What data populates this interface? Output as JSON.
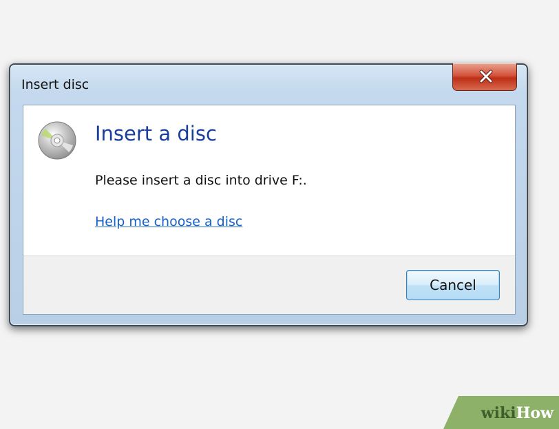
{
  "window": {
    "title": "Insert disc"
  },
  "dialog": {
    "main_instruction": "Insert a disc",
    "message": "Please insert a disc into drive F:.",
    "help_link": "Help me choose a disc",
    "cancel_label": "Cancel",
    "icons": {
      "close": "close-icon",
      "disc": "disc-icon"
    }
  },
  "watermark": {
    "wiki": "wiki",
    "how": "How",
    "accent_color": "#8db169"
  },
  "colors": {
    "instruction": "#1a3e9e",
    "link": "#1760c9",
    "close_button": "#c9432a"
  }
}
